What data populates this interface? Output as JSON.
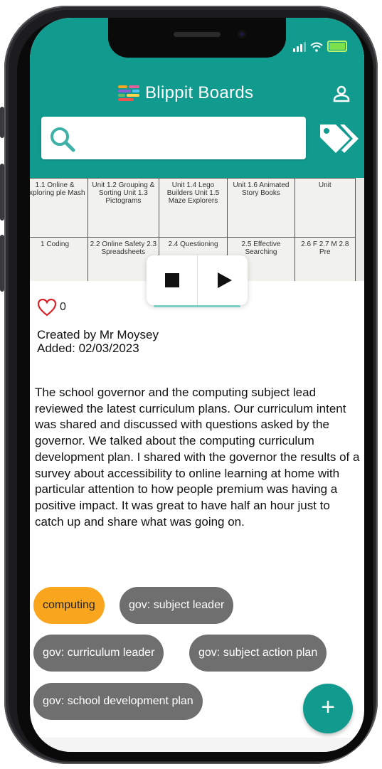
{
  "app": {
    "title": "Blippit Boards"
  },
  "colors": {
    "header": "#119b8f",
    "active_tag": "#f9a61e",
    "inactive_tag": "#6f6f6f",
    "like": "#d6242a"
  },
  "search": {
    "value": "",
    "placeholder": ""
  },
  "photo": {
    "row1": [
      "1.1 Online & Exploring ple Mash",
      "Unit 1.2 Grouping & Sorting Unit 1.3 Pictograms",
      "Unit 1.4 Lego Builders Unit 1.5 Maze Explorers",
      "Unit 1.6 Animated Story Books",
      "Unit"
    ],
    "row2": [
      "1 Coding",
      "2.2 Online Safety 2.3 Spreadsheets",
      "2.4 Questioning",
      "2.5 Effective Searching",
      "2.6 F 2.7 M 2.8 Pre"
    ]
  },
  "post": {
    "like_count": "0",
    "created_by": "Created by Mr Moysey",
    "added": "Added:  02/03/2023",
    "description": "The school governor and the computing subject lead reviewed the latest curriculum plans. Our curriculum intent was shared and discussed with questions asked by the governor. We talked about the computing curriculum development plan. I shared with the governor the results of a survey about accessibility to online learning at home with particular attention to how people premium was having a positive impact.  It was great to have half an hour just to catch up and share what was going on."
  },
  "tags": [
    {
      "label": "computing",
      "active": true
    },
    {
      "label": "gov: subject leader",
      "active": false
    },
    {
      "label": "gov: curriculum leader",
      "active": false
    },
    {
      "label": "gov: subject action plan",
      "active": false
    },
    {
      "label": "gov: school development plan",
      "active": false
    }
  ],
  "fab": {
    "label": "+"
  }
}
